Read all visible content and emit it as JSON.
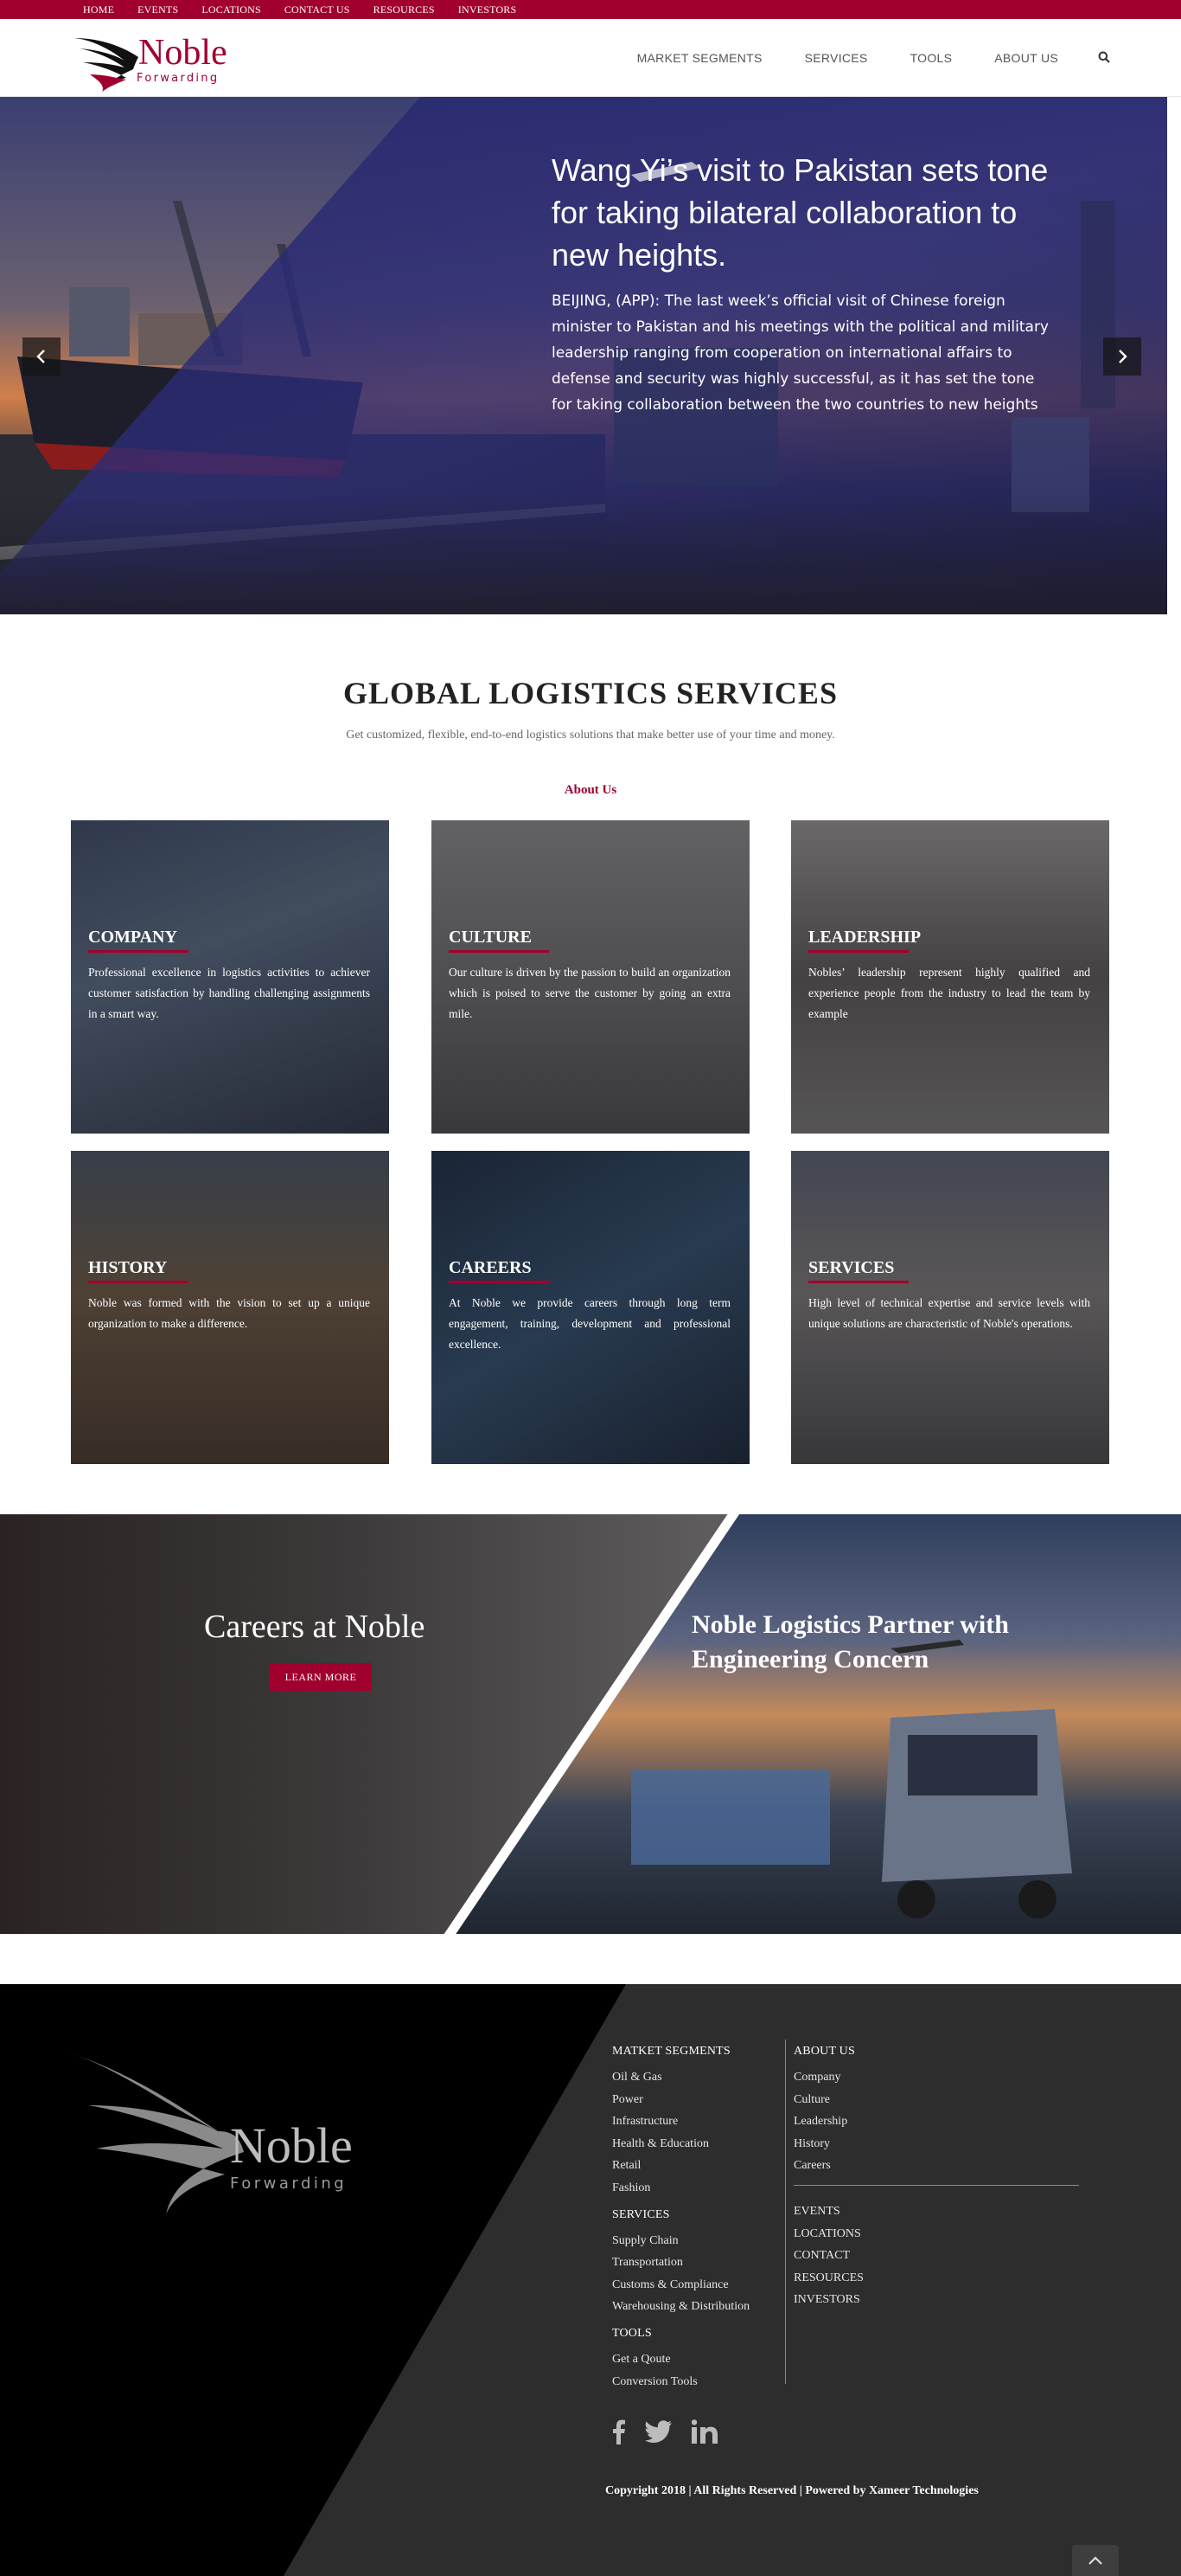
{
  "topbar": {
    "items": [
      "HOME",
      "EVENTS",
      "LOCATIONS",
      "CONTACT US",
      "RESOURCES",
      "INVESTORS"
    ]
  },
  "header": {
    "logo_word": "Noble",
    "logo_sub": "Forwarding",
    "nav": [
      "MARKET SEGMENTS",
      "SERVICES",
      "TOOLS",
      "ABOUT US"
    ],
    "search_icon": "search-icon"
  },
  "hero": {
    "title": "Wang Yi’s visit to Pakistan sets tone for taking bilateral collaboration to new heights.",
    "body": "BEIJING, (APP): The last week’s official visit of Chinese foreign minister to Pakistan and his meetings with the political and military leadership ranging from cooperation on international affairs to defense and security was highly successful, as it has set the tone for taking collaboration between the two countries to new heights",
    "prev_icon": "chevron-left-icon",
    "next_icon": "chevron-right-icon"
  },
  "services": {
    "title": "GLOBAL LOGISTICS SERVICES",
    "subtitle": "Get customized, flexible, end-to-end logistics solutions that make better use of your time and money.",
    "about_link": "About Us",
    "cards": [
      {
        "title": "COMPANY",
        "text": "Professional excellence in logistics activities to achiever customer satisfaction by handling challenging assignments in a smart way."
      },
      {
        "title": "CULTURE",
        "text": "Our culture is driven by the passion to build an organization which is poised to serve the customer by going an extra mile."
      },
      {
        "title": "LEADERSHIP",
        "text": "Nobles’ leadership represent highly qualified and experience people from the industry to lead the team by example"
      },
      {
        "title": "HISTORY",
        "text": "Noble was formed with the vision to set up a unique organization to make a difference."
      },
      {
        "title": "CAREERS",
        "text": "At Noble we provide careers through long term engagement, training, development and professional excellence."
      },
      {
        "title": "SERVICES",
        "text": "High level of technical expertise and service levels with unique solutions are characteristic of Noble's operations."
      }
    ]
  },
  "split": {
    "careers_title": "Careers at Noble",
    "learn_more": "LEARN MORE",
    "partner_title": "Noble Logistics Partner with Engineering Concern"
  },
  "footer": {
    "logo_word": "Noble",
    "logo_sub": "Forwarding",
    "market_heading": "MATKET SEGMENTS",
    "market_items": [
      "Oil & Gas",
      "Power",
      "Infrastructure",
      "Health & Education",
      "Retail",
      "Fashion"
    ],
    "services_heading": "SERVICES",
    "services_items": [
      "Supply Chain",
      "Transportation",
      "Customs & Compliance",
      "Warehousing & Distribution"
    ],
    "tools_heading": "TOOLS",
    "tools_items": [
      "Get a Qoute",
      "Conversion Tools"
    ],
    "about_heading": "ABOUT US",
    "about_items": [
      "Company",
      "Culture",
      "Leadership",
      "History",
      "Careers"
    ],
    "extra_items": [
      "EVENTS",
      "LOCATIONS",
      "CONTACT",
      "RESOURCES",
      "INVESTORS"
    ],
    "social": [
      "facebook-icon",
      "twitter-icon",
      "linkedin-icon"
    ],
    "copyright": "Copyright 2018 | All Rights Reserved | Powered by Xameer Technologies"
  },
  "colors": {
    "brand": "#a1002e",
    "footer_dark": "#000000",
    "footer_gray": "#2d2d2d"
  }
}
